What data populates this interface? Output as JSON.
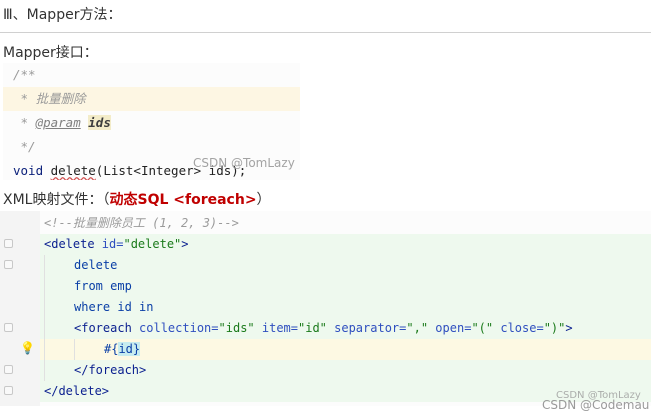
{
  "heading": "Ⅲ、Mapper方法：",
  "mapper_label": "Mapper接口：",
  "java_lines": {
    "l1": "/**",
    "l2_prefix": " * ",
    "l2_comment": "批量删除",
    "l3_prefix": " * ",
    "l3_tag": "@param",
    "l3_space": " ",
    "l3_param": "ids",
    "l4": " */",
    "l5_kw": "void",
    "l5_sp": " ",
    "l5_fn": "delete",
    "l5_rest": "(List<Integer> ids);"
  },
  "watermark1": "CSDN @TomLazy",
  "xml_label": {
    "prefix": "XML映射文件：（",
    "highlight": "动态SQL <foreach>",
    "suffix": "）"
  },
  "xml_lines": {
    "l1": "<!--批量删除员工 (1, 2, 3)-->",
    "l2_open": "<delete ",
    "l2_attr": "id=",
    "l2_val": "\"delete\"",
    "l2_close": ">",
    "l3": "delete",
    "l4": "from emp",
    "l5": "where id in",
    "l6_open": "<foreach ",
    "l6_a1": "collection=",
    "l6_v1": "\"ids\"",
    "l6_a2": " item=",
    "l6_v2": "\"id\"",
    "l6_a3": " separator=",
    "l6_v3": "\",\"",
    "l6_a4": " open=",
    "l6_v4": "\"(\"",
    "l6_a5": " close=",
    "l6_v5": "\")\"",
    "l6_close": ">",
    "l7_a": "#{",
    "l7_b": "id}",
    "l8": "</foreach>",
    "l9": "</delete>"
  },
  "watermark2": "CSDN @TomLazy",
  "watermark3": "CSDN @Codemau",
  "colors": {
    "accent_red": "#c00000",
    "green_highlight": "#eef9ee",
    "yellow_highlight": "#fdf9e3"
  }
}
